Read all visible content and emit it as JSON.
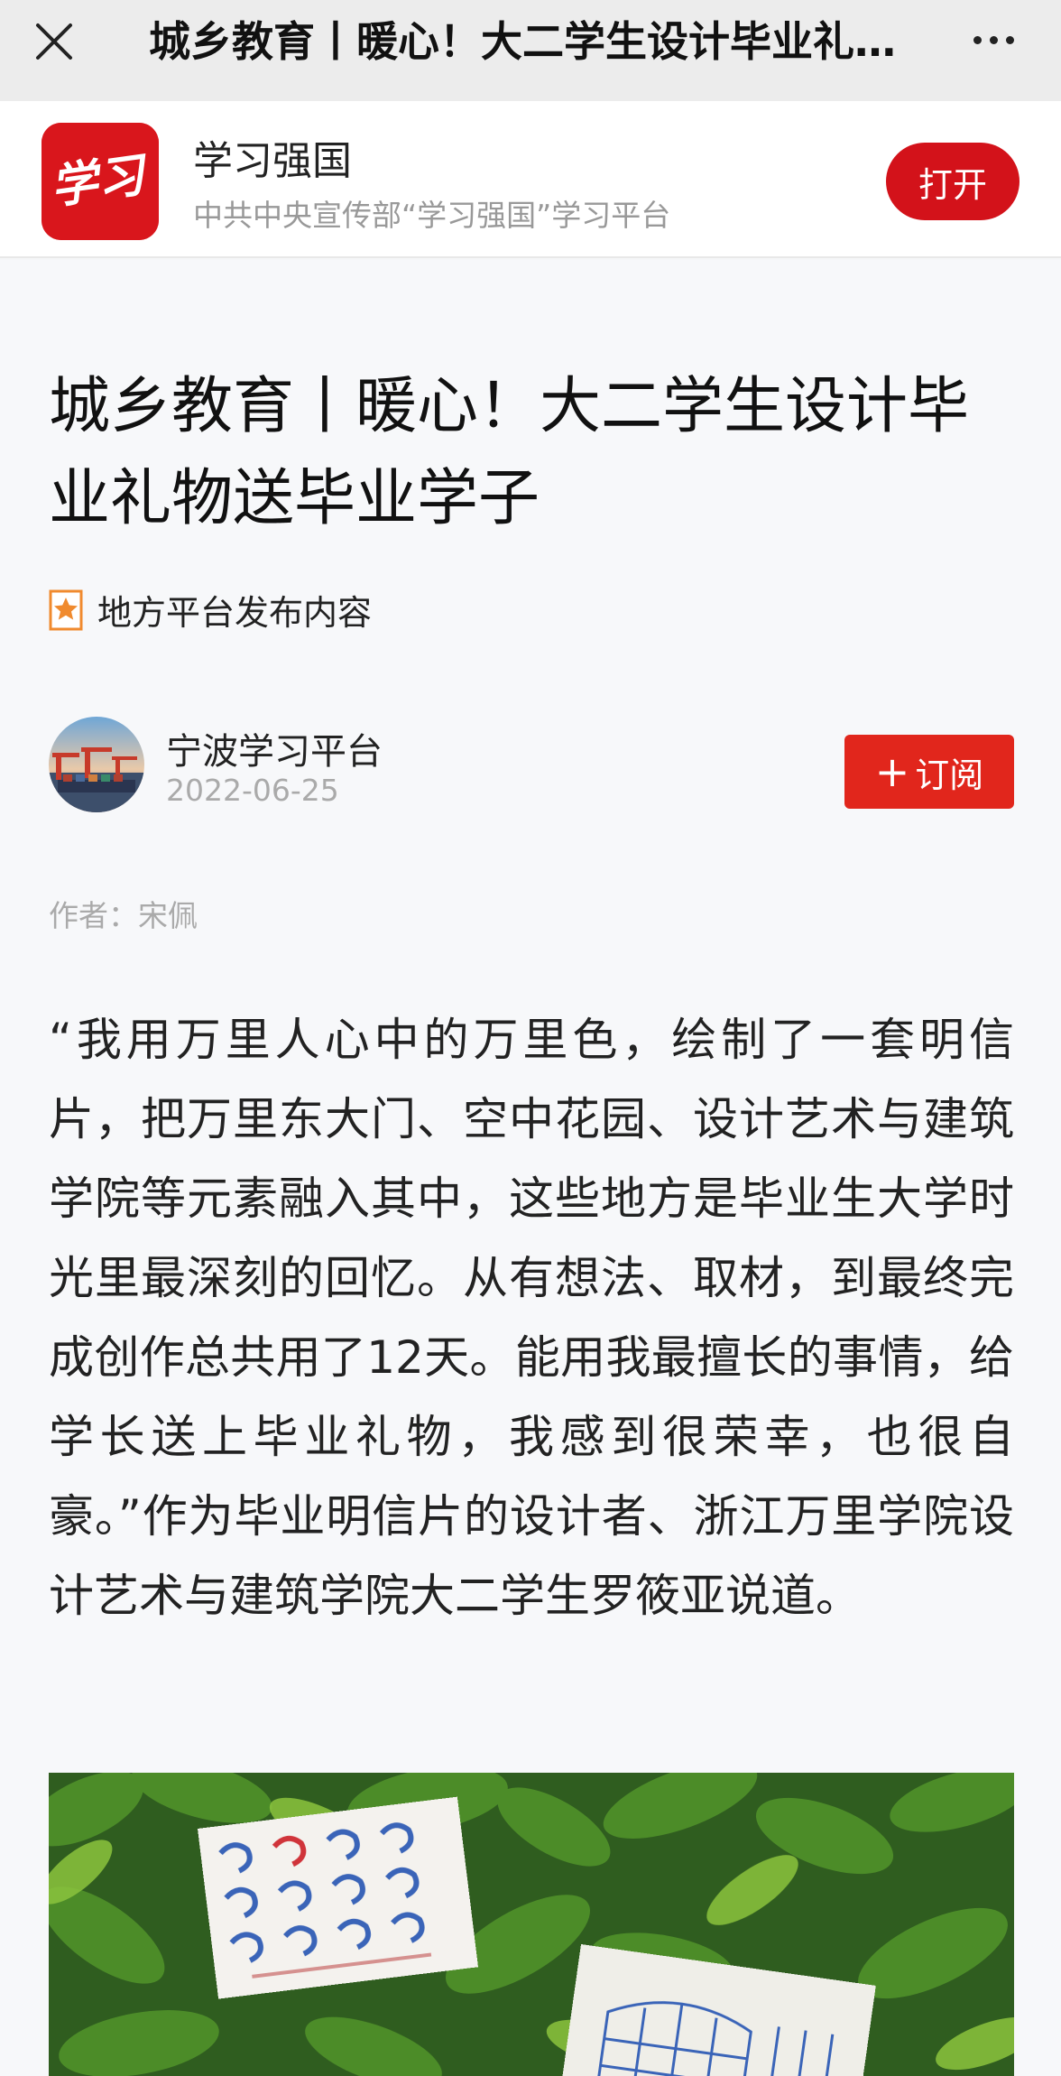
{
  "topbar": {
    "title": "城乡教育丨暖心！大二学生设计毕业礼物送毕业学子"
  },
  "app_banner": {
    "app_name": "学习强国",
    "app_desc": "中共中央宣传部“学习强国”学习平台",
    "open_label": "打开",
    "logo_text": "学习"
  },
  "article": {
    "headline": "城乡教育丨暖心！大二学生设计毕业礼物送毕业学子",
    "source_tag": "地方平台发布内容",
    "publisher": "宁波学习平台",
    "date": "2022-06-25",
    "subscribe_label": "订阅",
    "byline_label": "作者：",
    "byline_name": "宋佩",
    "body": "“我用万里人心中的万里色，绘制了一套明信片，把万里东大门、空中花园、设计艺术与建筑学院等元素融入其中，这些地方是毕业生大学时光里最深刻的回忆。从有想法、取材，到最终完成创作总共用了12天。能用我最擅长的事情，给学长送上毕业礼物，我感到很荣幸，也很自豪。”作为毕业明信片的设计者、浙江万里学院设计艺术与建筑学院大二学生罗筱亚说道。"
  },
  "colors": {
    "brand_red": "#d3121a",
    "subscribe_red": "#e1261c",
    "tag_orange": "#f08a2e"
  }
}
